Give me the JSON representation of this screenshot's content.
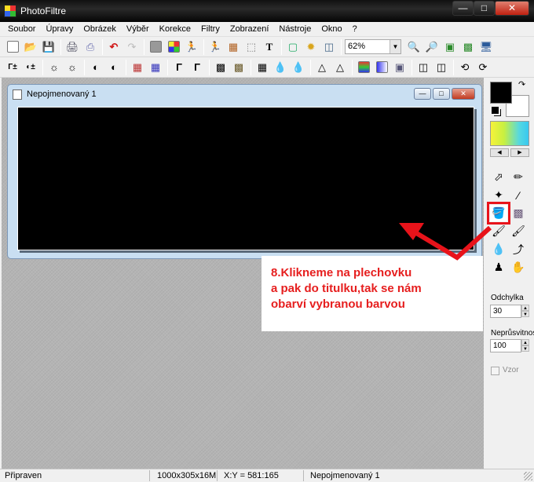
{
  "app": {
    "title": "PhotoFiltre",
    "window_buttons": {
      "minimize": "—",
      "maximize": "□",
      "close": "✕"
    }
  },
  "menu": [
    "Soubor",
    "Úpravy",
    "Obrázek",
    "Výběr",
    "Korekce",
    "Filtry",
    "Zobrazení",
    "Nástroje",
    "Okno",
    "?"
  ],
  "toolbar": {
    "zoom_value": "62%"
  },
  "document": {
    "title": "Nepojmenovaný 1"
  },
  "panel": {
    "odchylka_label": "Odchylka",
    "odchylka_value": "30",
    "opacity_label": "Neprůsvitnost",
    "opacity_value": "100",
    "pattern_label": "Vzor"
  },
  "annotation": {
    "lines": [
      "8.Klikneme na plechovku",
      "a pak do titulku,tak se nám",
      "obarví vybranou barvou"
    ]
  },
  "status": {
    "state": "Připraven",
    "size": "1000x305x16M",
    "coords": "X:Y = 581:165",
    "doc": "Nepojmenovaný 1"
  }
}
